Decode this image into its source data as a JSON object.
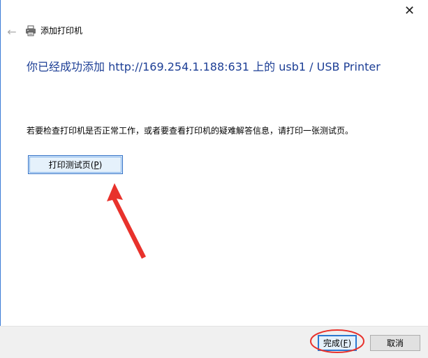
{
  "window": {
    "title": "添加打印机",
    "close_symbol": "✕",
    "back_symbol": "←",
    "icons": {
      "back": "back-arrow-icon",
      "printer": "printer-icon",
      "close": "close-icon"
    }
  },
  "content": {
    "heading": "你已经成功添加 http://169.254.1.188:631 上的 usb1 / USB Printer",
    "instruction": "若要检查打印机是否正常工作，或者要查看打印机的疑难解答信息，请打印一张测试页。",
    "print_test_button": {
      "label": "打印测试页",
      "access_key": "P"
    }
  },
  "footer": {
    "finish_button": {
      "label": "完成",
      "access_key": "F"
    },
    "cancel_button": {
      "label": "取消"
    }
  },
  "annotations": {
    "accent_color": "#e8322c",
    "arrow_points_to": "print-test-button",
    "circle_around": "finish-button"
  },
  "colors": {
    "heading": "#1c3e95",
    "footer_bg": "#f0f0f0",
    "focus_border": "#2b78d0"
  }
}
